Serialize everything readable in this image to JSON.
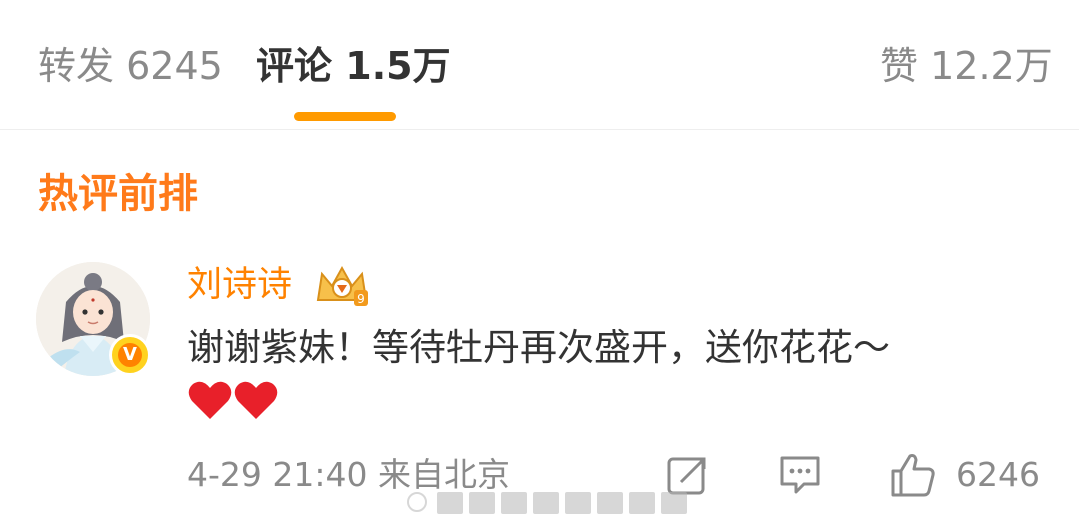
{
  "tabs": {
    "repost": {
      "label": "转发",
      "count": "6245"
    },
    "comment": {
      "label": "评论",
      "count": "1.5万"
    },
    "like": {
      "label": "赞",
      "count": "12.2万"
    }
  },
  "section": {
    "title": "热评前排"
  },
  "comment": {
    "username": "刘诗诗",
    "text": "谢谢紫妹！等待牡丹再次盛开，送你花花～",
    "emojis": [
      "heart",
      "heart"
    ],
    "time": "4-29 21:40",
    "location": "来自北京",
    "like_count": "6246"
  },
  "colors": {
    "accent": "#ff8200",
    "section_title": "#ff7a1a",
    "indicator": "#ff9a00",
    "muted": "#8a8a8a"
  },
  "icons": [
    "verified-v-icon",
    "vip-crown-icon",
    "repost-icon",
    "comment-icon",
    "like-icon"
  ]
}
